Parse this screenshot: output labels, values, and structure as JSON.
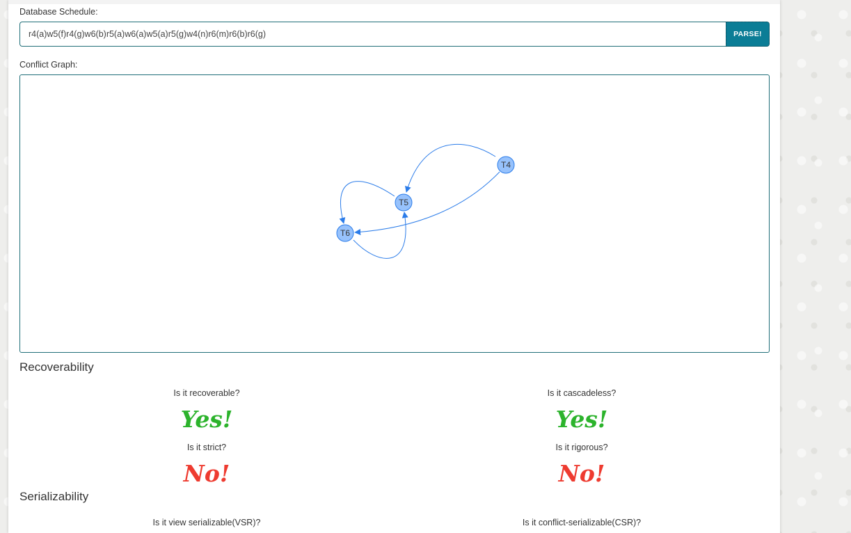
{
  "schedule": {
    "label": "Database Schedule:",
    "value": "r4(a)w5(f)r4(g)w6(b)r5(a)w6(a)w5(a)r5(g)w4(n)r6(m)r6(b)r6(g)",
    "parse_label": "PARSE!"
  },
  "graph": {
    "label": "Conflict Graph:",
    "nodes": [
      "T4",
      "T5",
      "T6"
    ],
    "edges": [
      {
        "from": "T4",
        "to": "T5"
      },
      {
        "from": "T4",
        "to": "T6"
      },
      {
        "from": "T5",
        "to": "T6"
      },
      {
        "from": "T6",
        "to": "T5"
      }
    ],
    "node_color": "#97c2fc",
    "edge_color": "#2b7ce9"
  },
  "recoverability": {
    "title": "Recoverability",
    "recoverable": {
      "question": "Is it recoverable?",
      "answer": "Yes!"
    },
    "cascadeless": {
      "question": "Is it cascadeless?",
      "answer": "Yes!"
    },
    "strict": {
      "question": "Is it strict?",
      "answer": "No!"
    },
    "rigorous": {
      "question": "Is it rigorous?",
      "answer": "No!"
    }
  },
  "serializability": {
    "title": "Serializability",
    "vsr": {
      "question": "Is it view serializable(VSR)?"
    },
    "csr": {
      "question": "Is it conflict-serializable(CSR)?"
    }
  },
  "colors": {
    "accent": "#0b7d96",
    "yes": "#2cb32c",
    "no": "#ee3b30"
  }
}
